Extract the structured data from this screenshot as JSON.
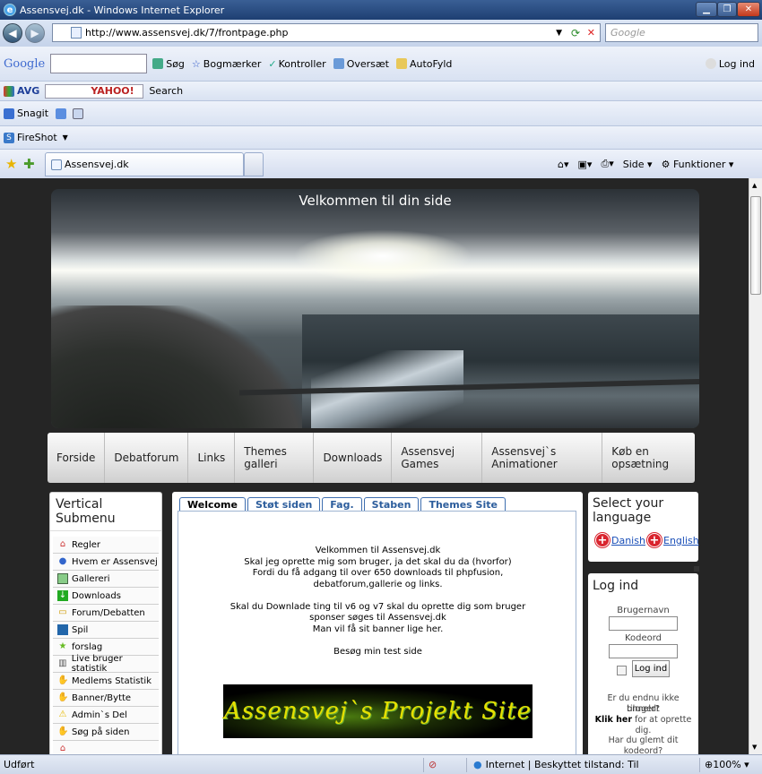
{
  "window": {
    "title": "Assensvej.dk - Windows Internet Explorer"
  },
  "address": {
    "url": "http://www.assensvej.dk/7/frontpage.php",
    "search_placeholder": "Google"
  },
  "google_toolbar": {
    "logo": "Google",
    "items": [
      "Søg",
      "Bogmærker",
      "Kontroller",
      "Oversæt",
      "AutoFyld",
      "Log ind"
    ]
  },
  "avg_toolbar": {
    "label": "AVG",
    "yahoo": "YAHOO!",
    "search": "Search"
  },
  "snagit_toolbar": {
    "label": "Snagit"
  },
  "fireshot_toolbar": {
    "label": "FireShot"
  },
  "tabs_row": {
    "tab_title": "Assensvej.dk",
    "commands": [
      "Side",
      "Funktioner"
    ]
  },
  "page": {
    "banner_title": "Velkommen til din side",
    "nav": [
      "Forside",
      "Debatforum",
      "Links",
      "Themes galleri",
      "Downloads",
      "Assensvej Games",
      "Assensvej`s Animationer",
      "Køb en opsætning"
    ],
    "submenu": {
      "title": "Vertical Submenu",
      "items": [
        "Regler",
        "Hvem er Assensvej",
        "Gallereri",
        "Downloads",
        "Forum/Debatten",
        "Spil",
        "forslag",
        "Live bruger statistik",
        "Medlems Statistik",
        "Banner/Bytte",
        "Admin`s Del",
        "Søg på siden"
      ]
    },
    "center_tabs": [
      "Welcome",
      "Støt siden",
      "Fag.",
      "Staben",
      "Themes Site"
    ],
    "welcome_lines": [
      "Velkommen til Assensvej.dk",
      "Skal jeg oprette mig som bruger, ja det skal du da (hvorfor)",
      "Fordi du få adgang til over 650 downloads til phpfusion,",
      "debatforum,gallerie og links.",
      "",
      "Skal du Downlade ting til v6 og v7 skal du oprette dig som bruger",
      "sponser søges til Assensvej.dk",
      "Man vil få sit banner lige her.",
      "",
      "Besøg min test side"
    ],
    "project_banner": "Assensvej`s Projekt Site",
    "language": {
      "title": "Select your language",
      "danish": "Danish",
      "english": "English"
    },
    "login": {
      "title": "Log ind",
      "username_label": "Brugernavn",
      "password_label": "Kodeord",
      "button": "Log ind",
      "register_q1": "Er du endnu ikke tilmeldt",
      "register_q2": "bruger?",
      "register_link": "Klik her",
      "register_rest": "for at oprette dig.",
      "forgot": "Har du glemt dit kodeord?"
    }
  },
  "status": {
    "left": "Udført",
    "zone": "Internet | Beskyttet tilstand: Til",
    "zoom": "100%"
  },
  "colors": {
    "title_bar": "#1e3f72",
    "link": "#1a4fb8",
    "tab_text": "#2c5d9c",
    "page_bg": "#252525"
  }
}
